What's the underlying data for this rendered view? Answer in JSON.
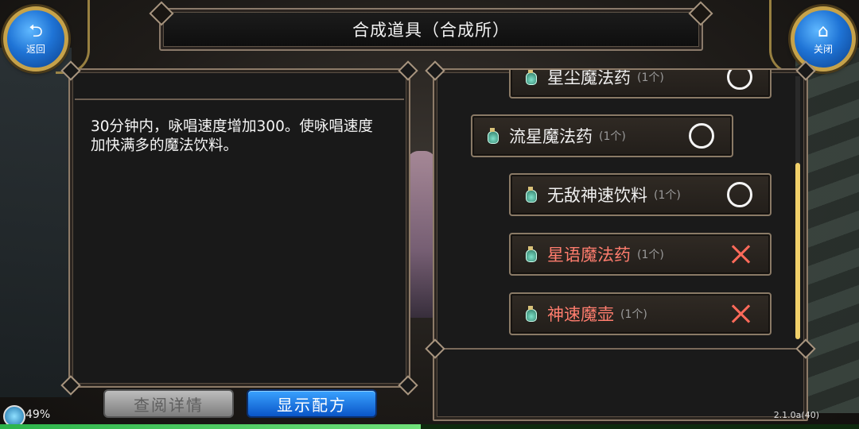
{
  "header": {
    "title": "合成道具（合成所）",
    "back_label": "返回",
    "close_label": "关闭"
  },
  "description": {
    "text": "30分钟内，咏唱速度增加300。使咏唱速度加快满多的魔法饮料。"
  },
  "buttons": {
    "details_label": "查阅详情",
    "recipe_label": "显示配方"
  },
  "recipe_list": [
    {
      "name": "星尘魔法药",
      "qty": "(1个)",
      "status": "available"
    },
    {
      "name": "流星魔法药",
      "qty": "(1个)",
      "status": "available"
    },
    {
      "name": "无敌神速饮料",
      "qty": "(1个)",
      "status": "available"
    },
    {
      "name": "星语魔法药",
      "qty": "(1个)",
      "status": "missing"
    },
    {
      "name": "神速魔壶",
      "qty": "(1个)",
      "status": "missing"
    }
  ],
  "status": {
    "battery": "49%",
    "version": "2.1.0a(40)"
  },
  "colors": {
    "missing_text": "#ff7d6e",
    "button_blue": "#1a78e8",
    "frame_gold": "#c6a24a"
  },
  "icons": {
    "back": "back-arrow-icon",
    "close": "home-icon",
    "potion": "potion-icon"
  }
}
